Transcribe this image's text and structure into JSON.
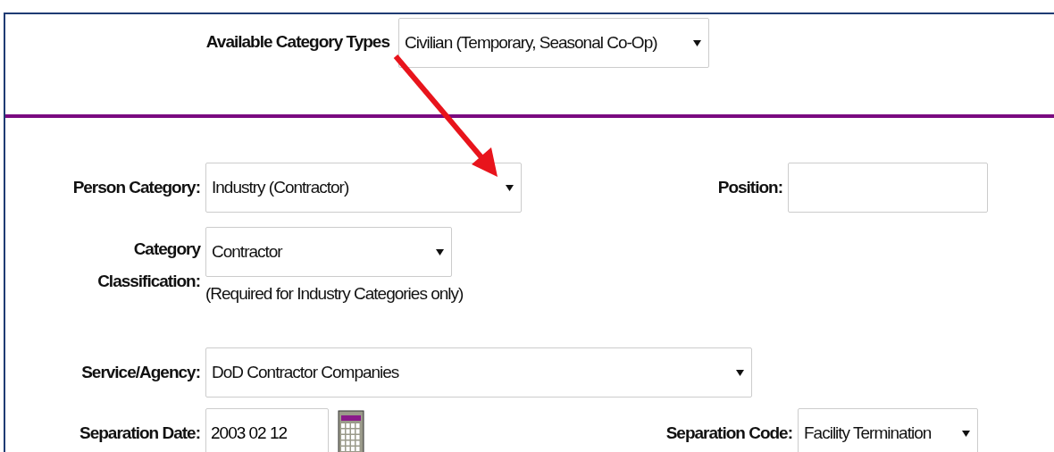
{
  "category_types": {
    "label": "Available Category Types",
    "value": "Civilian (Temporary, Seasonal Co-Op)"
  },
  "person_category": {
    "label": "Person Category:",
    "value": "Industry (Contractor)"
  },
  "position": {
    "label": "Position:"
  },
  "category_classification": {
    "label_lines": [
      "Category",
      "Classification:"
    ],
    "value": "Contractor",
    "hint": "(Required for Industry Categories only)"
  },
  "service_agency": {
    "label": "Service/Agency:",
    "value": "DoD Contractor Companies"
  },
  "separation_date": {
    "label": "Separation Date:",
    "value": "2003 02 12"
  },
  "separation_code": {
    "label": "Separation Code:",
    "value": "Facility Termination"
  }
}
